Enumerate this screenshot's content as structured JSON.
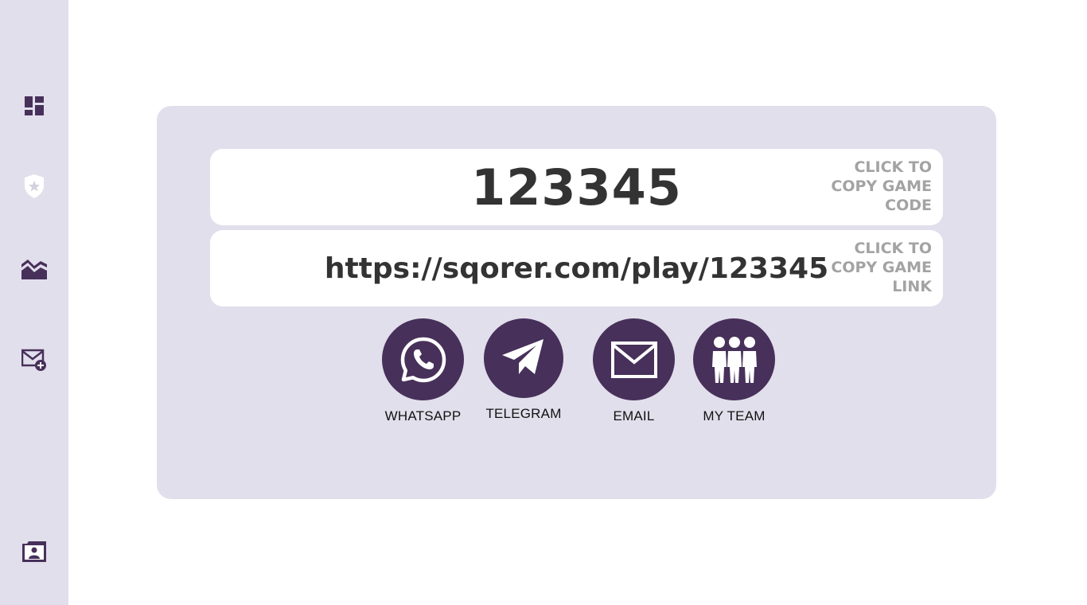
{
  "sidebar": {
    "items": [
      {
        "icon": "dashboard-icon"
      },
      {
        "icon": "shield-star-icon"
      },
      {
        "icon": "area-chart-icon"
      },
      {
        "icon": "mail-add-icon"
      },
      {
        "icon": "contact-folder-icon"
      }
    ]
  },
  "game": {
    "code": "123345",
    "code_hint": "CLICK TO COPY GAME CODE",
    "link": "https://sqorer.com/play/123345",
    "link_hint": "CLICK TO COPY GAME LINK"
  },
  "share": {
    "whatsapp_label": "WHATSAPP",
    "telegram_label": "TELEGRAM",
    "email_label": "EMAIL",
    "team_label": "MY TEAM"
  },
  "colors": {
    "accent": "#47305a",
    "panel": "#e2dfec",
    "text": "#333333",
    "hint": "#a3a3a3"
  }
}
